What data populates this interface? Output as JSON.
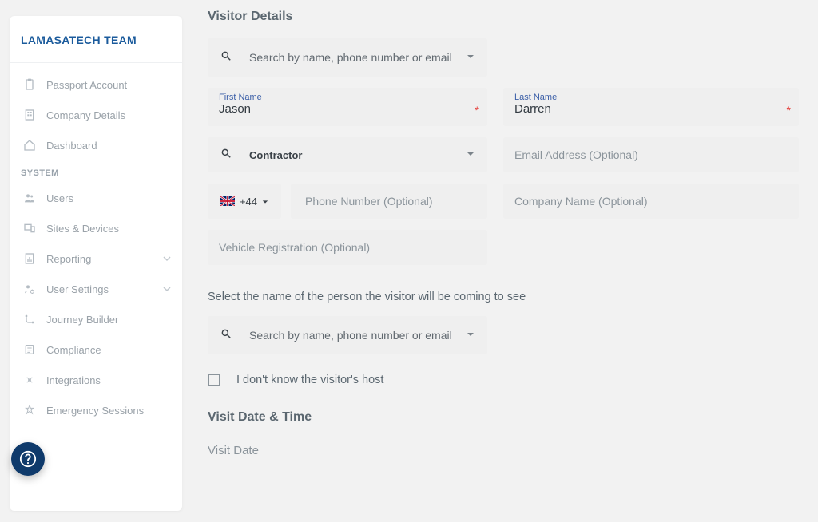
{
  "brand": "LAMASATECH TEAM",
  "sidebar": {
    "top": [
      {
        "label": "Passport Account"
      },
      {
        "label": "Company Details"
      },
      {
        "label": "Dashboard"
      }
    ],
    "system_label": "SYSTEM",
    "system": [
      {
        "label": "Users"
      },
      {
        "label": "Sites & Devices"
      },
      {
        "label": "Reporting",
        "expandable": true
      },
      {
        "label": "User Settings",
        "expandable": true
      },
      {
        "label": "Journey Builder"
      },
      {
        "label": "Compliance"
      },
      {
        "label": "Integrations"
      },
      {
        "label": "Emergency Sessions"
      }
    ]
  },
  "visitor": {
    "title": "Visitor Details",
    "search_placeholder": "Search by name, phone number or email",
    "first_name_label": "First Name",
    "first_name_value": "Jason",
    "last_name_label": "Last Name",
    "last_name_value": "Darren",
    "category_value": "Contractor",
    "email_placeholder": "Email Address (Optional)",
    "phone_code": "+44",
    "phone_placeholder": "Phone Number (Optional)",
    "company_placeholder": "Company Name (Optional)",
    "vehicle_placeholder": "Vehicle Registration (Optional)",
    "host_help": "Select the name of the person the visitor will be coming to see",
    "host_search_placeholder": "Search by name, phone number or email",
    "unknown_host_label": "I don't know the visitor's host",
    "visit_datetime_title": "Visit Date & Time",
    "visit_date_label": "Visit Date"
  }
}
